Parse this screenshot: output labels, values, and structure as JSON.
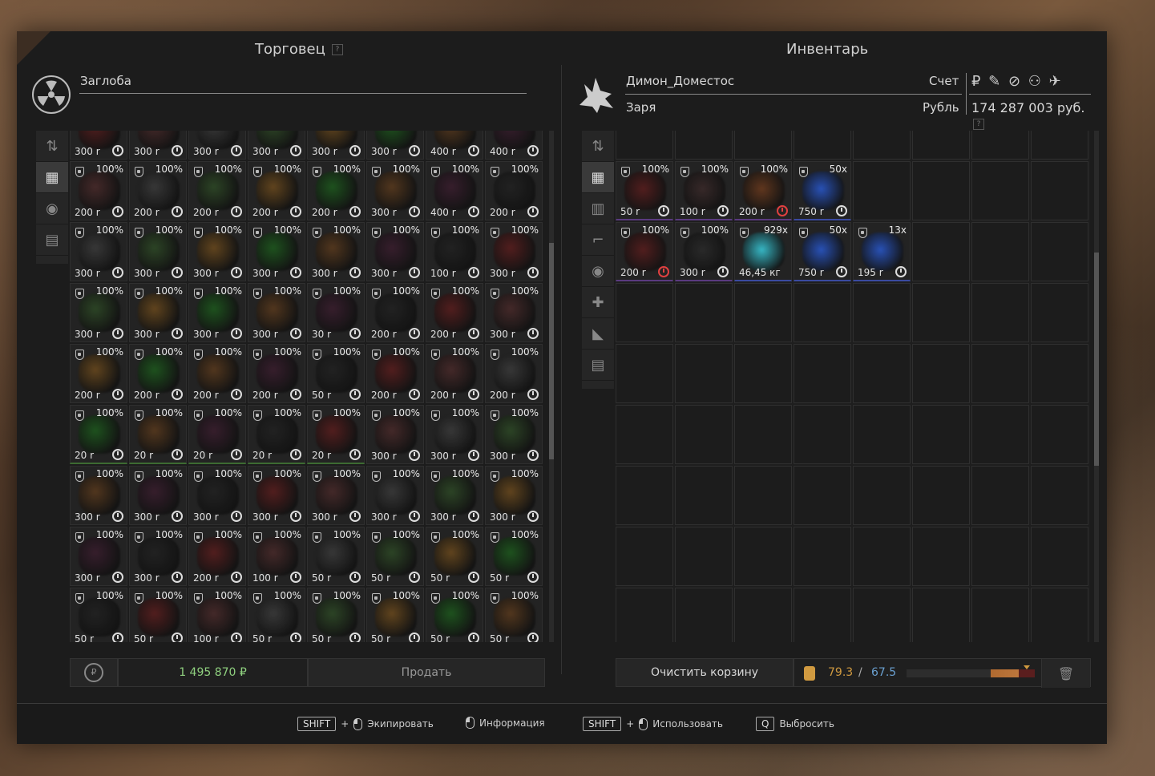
{
  "trader": {
    "title": "Торговец",
    "help": "?",
    "name": "Заглоба",
    "money": "1 495 870 ₽",
    "sell_label": "Продать"
  },
  "inventory": {
    "title": "Инвентарь",
    "player": "Димон_Доместос",
    "faction": "Заря",
    "account_label": "Счет",
    "currency_label": "Рубль",
    "currency_icons": "₽ ✎ ⊘ ⚇ ✈",
    "balance": "174 287 003 руб.",
    "balance_help": "?",
    "clear_label": "Очистить корзину",
    "weight_current": "79.3",
    "weight_sep": "/",
    "weight_max": "67.5",
    "weight_fraction": 1.17
  },
  "trader_rows": [
    [
      [
        "300 r",
        ""
      ],
      [
        "300 r",
        ""
      ],
      [
        "300 r",
        ""
      ],
      [
        "300 r",
        ""
      ],
      [
        "300 r",
        ""
      ],
      [
        "300 r",
        ""
      ],
      [
        "400 r",
        ""
      ],
      [
        "400 r",
        ""
      ]
    ],
    [
      [
        "200 r",
        "100%"
      ],
      [
        "200 r",
        "100%"
      ],
      [
        "200 r",
        "100%"
      ],
      [
        "200 r",
        "100%"
      ],
      [
        "200 r",
        "100%"
      ],
      [
        "300 r",
        "100%"
      ],
      [
        "400 r",
        "100%"
      ],
      [
        "200 r",
        "100%"
      ]
    ],
    [
      [
        "300 r",
        "100%"
      ],
      [
        "300 r",
        "100%"
      ],
      [
        "300 r",
        "100%"
      ],
      [
        "300 r",
        "100%"
      ],
      [
        "300 r",
        "100%"
      ],
      [
        "300 r",
        "100%"
      ],
      [
        "100 r",
        "100%"
      ],
      [
        "300 r",
        "100%"
      ]
    ],
    [
      [
        "300 r",
        "100%"
      ],
      [
        "300 r",
        "100%"
      ],
      [
        "300 r",
        "100%"
      ],
      [
        "300 r",
        "100%"
      ],
      [
        "30 r",
        "100%"
      ],
      [
        "200 r",
        "100%"
      ],
      [
        "200 r",
        "100%"
      ],
      [
        "300 r",
        "100%"
      ]
    ],
    [
      [
        "200 r",
        "100%"
      ],
      [
        "200 r",
        "100%"
      ],
      [
        "200 r",
        "100%"
      ],
      [
        "200 r",
        "100%"
      ],
      [
        "50 r",
        "100%"
      ],
      [
        "200 r",
        "100%"
      ],
      [
        "200 r",
        "100%"
      ],
      [
        "200 r",
        "100%"
      ]
    ],
    [
      [
        "20 r",
        "100%"
      ],
      [
        "20 r",
        "100%"
      ],
      [
        "20 r",
        "100%"
      ],
      [
        "20 r",
        "100%"
      ],
      [
        "20 r",
        "100%"
      ],
      [
        "300 r",
        "100%"
      ],
      [
        "300 r",
        "100%"
      ],
      [
        "300 r",
        "100%"
      ]
    ],
    [
      [
        "300 r",
        "100%"
      ],
      [
        "300 r",
        "100%"
      ],
      [
        "300 r",
        "100%"
      ],
      [
        "300 r",
        "100%"
      ],
      [
        "300 r",
        "100%"
      ],
      [
        "300 r",
        "100%"
      ],
      [
        "300 r",
        "100%"
      ],
      [
        "300 r",
        "100%"
      ]
    ],
    [
      [
        "300 r",
        "100%"
      ],
      [
        "300 r",
        "100%"
      ],
      [
        "200 r",
        "100%"
      ],
      [
        "100 r",
        "100%"
      ],
      [
        "50 r",
        "100%"
      ],
      [
        "50 r",
        "100%"
      ],
      [
        "50 r",
        "100%"
      ],
      [
        "50 r",
        "100%"
      ]
    ],
    [
      [
        "50 r",
        "100%"
      ],
      [
        "50 r",
        "100%"
      ],
      [
        "100 r",
        "100%"
      ],
      [
        "50 r",
        "100%"
      ],
      [
        "50 r",
        "100%"
      ],
      [
        "50 r",
        "100%"
      ],
      [
        "50 r",
        "100%"
      ],
      [
        "50 r",
        "100%"
      ]
    ]
  ],
  "inv_items": [
    {
      "top": "100%",
      "price": "50 r",
      "red": false
    },
    {
      "top": "100%",
      "price": "100 r",
      "red": false
    },
    {
      "top": "100%",
      "price": "200 r",
      "red": true
    },
    {
      "top": "50x",
      "price": "750 r",
      "red": false
    },
    {
      "top": "100%",
      "price": "200 r",
      "red": true
    },
    {
      "top": "100%",
      "price": "300 r",
      "red": false
    },
    {
      "top": "929x",
      "price": "46,45 кг",
      "red": false
    },
    {
      "top": "50x",
      "price": "750 r",
      "red": false
    },
    {
      "top": "13x",
      "price": "195 r",
      "red": false
    }
  ],
  "footer": {
    "shift1": "SHIFT",
    "plus1": "+",
    "equip": "Экипировать",
    "info": "Информация",
    "shift2": "SHIFT",
    "plus2": "+",
    "use": "Использовать",
    "qkey": "Q",
    "drop": "Выбросить"
  },
  "colors": {
    "money_green": "#8fd07f",
    "weight_orange": "#d09a40",
    "weight_blue": "#6aa0d0",
    "alert_red": "#e04040"
  }
}
